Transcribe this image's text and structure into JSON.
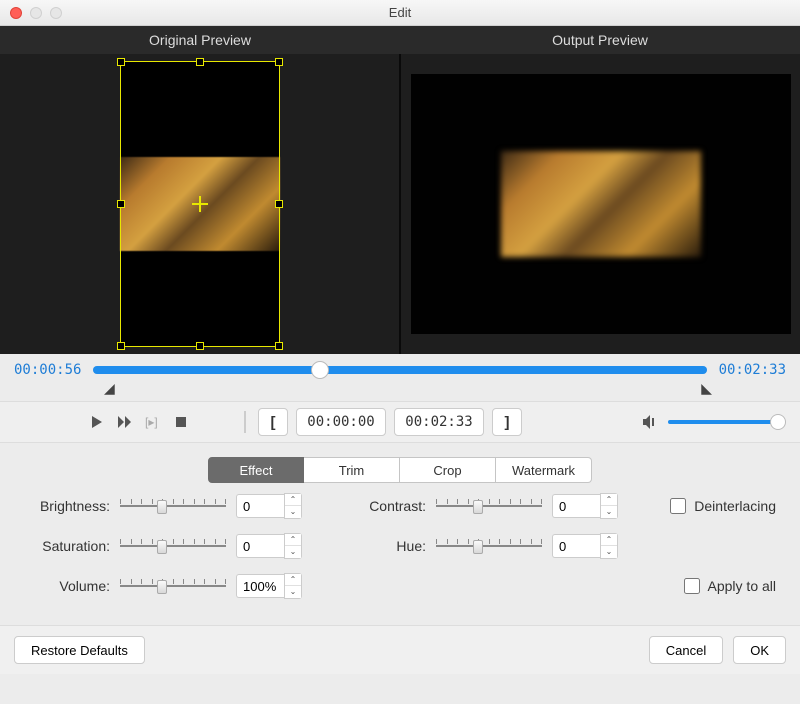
{
  "window": {
    "title": "Edit"
  },
  "preview": {
    "original_label": "Original Preview",
    "output_label": "Output Preview"
  },
  "timeline": {
    "current": "00:00:56",
    "total": "00:02:33",
    "progress_pct": 37,
    "left_marker_glyph": "◢",
    "right_marker_glyph": "◣"
  },
  "transport": {
    "in_time": "00:00:00",
    "out_time": "00:02:33",
    "bracket_left": "[",
    "bracket_right": "]",
    "volume_icon": "🔈",
    "volume_pct": 95
  },
  "tabs": [
    {
      "label": "Effect",
      "active": true
    },
    {
      "label": "Trim",
      "active": false
    },
    {
      "label": "Crop",
      "active": false
    },
    {
      "label": "Watermark",
      "active": false
    }
  ],
  "effects": {
    "brightness": {
      "label": "Brightness:",
      "value": "0",
      "pos": 40
    },
    "contrast": {
      "label": "Contrast:",
      "value": "0",
      "pos": 40
    },
    "saturation": {
      "label": "Saturation:",
      "value": "0",
      "pos": 40
    },
    "hue": {
      "label": "Hue:",
      "value": "0",
      "pos": 40
    },
    "volume": {
      "label": "Volume:",
      "value": "100%",
      "pos": 40
    }
  },
  "checks": {
    "deinterlacing_label": "Deinterlacing",
    "apply_all_label": "Apply to all"
  },
  "buttons": {
    "restore": "Restore Defaults",
    "cancel": "Cancel",
    "ok": "OK"
  }
}
